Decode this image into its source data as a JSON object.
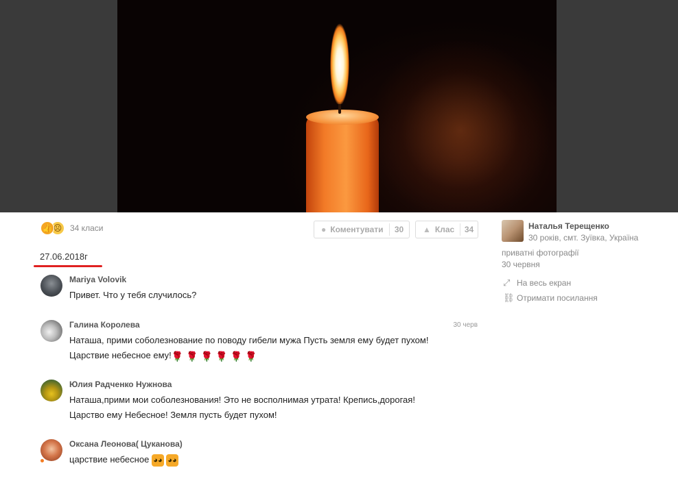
{
  "photo": {
    "description_icon": "candle-photo"
  },
  "actions": {
    "reactions_count": "34 класи",
    "comment_label": "Коментувати",
    "comment_count": "30",
    "class_label": "Клас",
    "class_count": "34"
  },
  "post": {
    "date": "27.06.2018г"
  },
  "comments": [
    {
      "author": "Mariya Volovik",
      "text": "Привет. Что у тебя случилось?",
      "time": ""
    },
    {
      "author": "Галина Королева",
      "line1": "Наташа, прими соболезнование по поводу гибели мужа  Пусть земля ему будет пухом!",
      "line2": "Царствие небесное ему!",
      "time": "30 черв"
    },
    {
      "author": "Юлия Радченко Нужнова",
      "line1": "Наташа,прими мои соболезнования! Это не восполнимая  утрата! Крепись,дорогая!",
      "line2": "Царство ему Небесное! Земля пусть будет пухом!"
    },
    {
      "author": "Оксана Леонова( Цуканова)",
      "text": "царствие небесное"
    }
  ],
  "sidebar": {
    "owner_name": "Наталья Терещенко",
    "owner_info": "30 років, смт. Зуївка, Україна",
    "album": "приватні фотографії",
    "date": "30 червня",
    "fullscreen": "На весь екран",
    "get_link": "Отримати посилання"
  },
  "colors": {
    "accent": "#f37c22",
    "date_underline": "#e02020"
  }
}
